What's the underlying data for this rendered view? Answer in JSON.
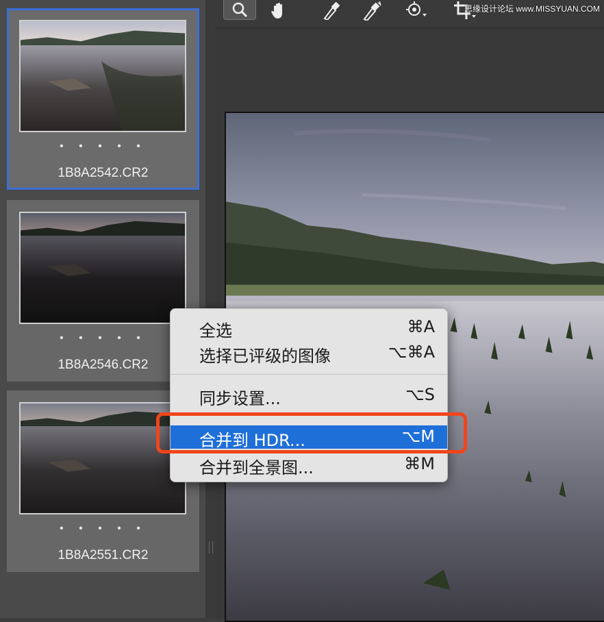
{
  "filmstrip": {
    "items": [
      {
        "filename": "1B8A2542.CR2",
        "rating_dots": "• • • • •",
        "selected": true
      },
      {
        "filename": "1B8A2546.CR2",
        "rating_dots": "• • • • •",
        "selected": false
      },
      {
        "filename": "1B8A2551.CR2",
        "rating_dots": "• • • • •",
        "selected": false
      }
    ]
  },
  "toolbar": {
    "tools": [
      "zoom-icon",
      "hand-icon",
      "white-balance-icon",
      "color-sampler-icon",
      "targeted-adjustment-icon",
      "crop-icon"
    ],
    "watermark": "思缘设计论坛 www.MISSYUAN.COM"
  },
  "context_menu": {
    "items": [
      {
        "label": "全选",
        "shortcut": "⌘A"
      },
      {
        "label": "选择已评级的图像",
        "shortcut": "⌥⌘A"
      },
      {
        "label": "同步设置...",
        "shortcut": "⌥S"
      },
      {
        "label": "合并到 HDR...",
        "shortcut": "⌥M",
        "highlighted": true
      },
      {
        "label": "合并到全景图...",
        "shortcut": "⌘M"
      }
    ]
  },
  "colors": {
    "selection_border": "#3b6fd8",
    "menu_highlight": "#1f6fd9",
    "annotation_box": "#f0451c"
  }
}
